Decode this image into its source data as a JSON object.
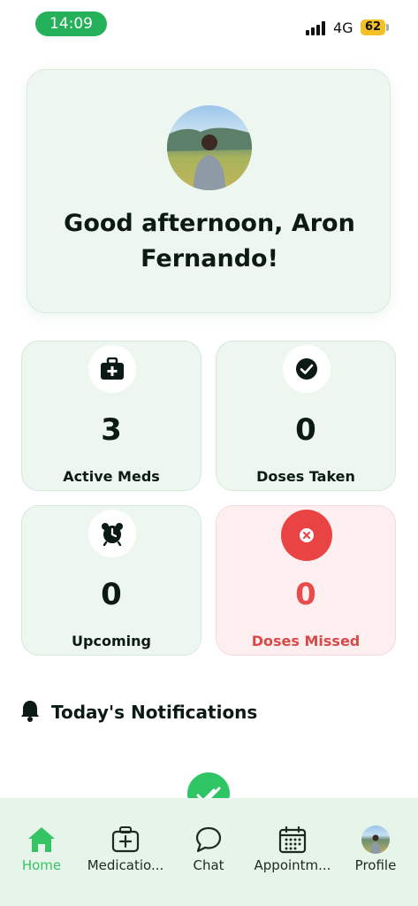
{
  "status_bar": {
    "time": "14:09",
    "network": "4G",
    "battery": "62"
  },
  "greeting": {
    "text": "Good afternoon, Aron Fernando!",
    "avatar_icon": "profile-photo"
  },
  "stats": [
    {
      "icon": "medicine-kit-icon",
      "value": "3",
      "label": "Active Meds"
    },
    {
      "icon": "check-circle-icon",
      "value": "0",
      "label": "Doses Taken"
    },
    {
      "icon": "alarm-clock-icon",
      "value": "0",
      "label": "Upcoming"
    },
    {
      "icon": "close-circle-icon",
      "value": "0",
      "label": "Doses Missed"
    }
  ],
  "notifications": {
    "title": "Today's Notifications",
    "icon": "bell-icon"
  },
  "bottom_nav": [
    {
      "label": "Home",
      "icon": "home-icon",
      "active": true
    },
    {
      "label": "Medicatio...",
      "icon": "medication-icon",
      "active": false
    },
    {
      "label": "Chat",
      "icon": "chat-icon",
      "active": false
    },
    {
      "label": "Appointm...",
      "icon": "calendar-icon",
      "active": false
    },
    {
      "label": "Profile",
      "icon": "avatar",
      "active": false
    }
  ],
  "colors": {
    "accent_green": "#34c463",
    "card_bg": "#edf7f0",
    "missed_red": "#e74b4b",
    "missed_bg": "#fdefef"
  }
}
